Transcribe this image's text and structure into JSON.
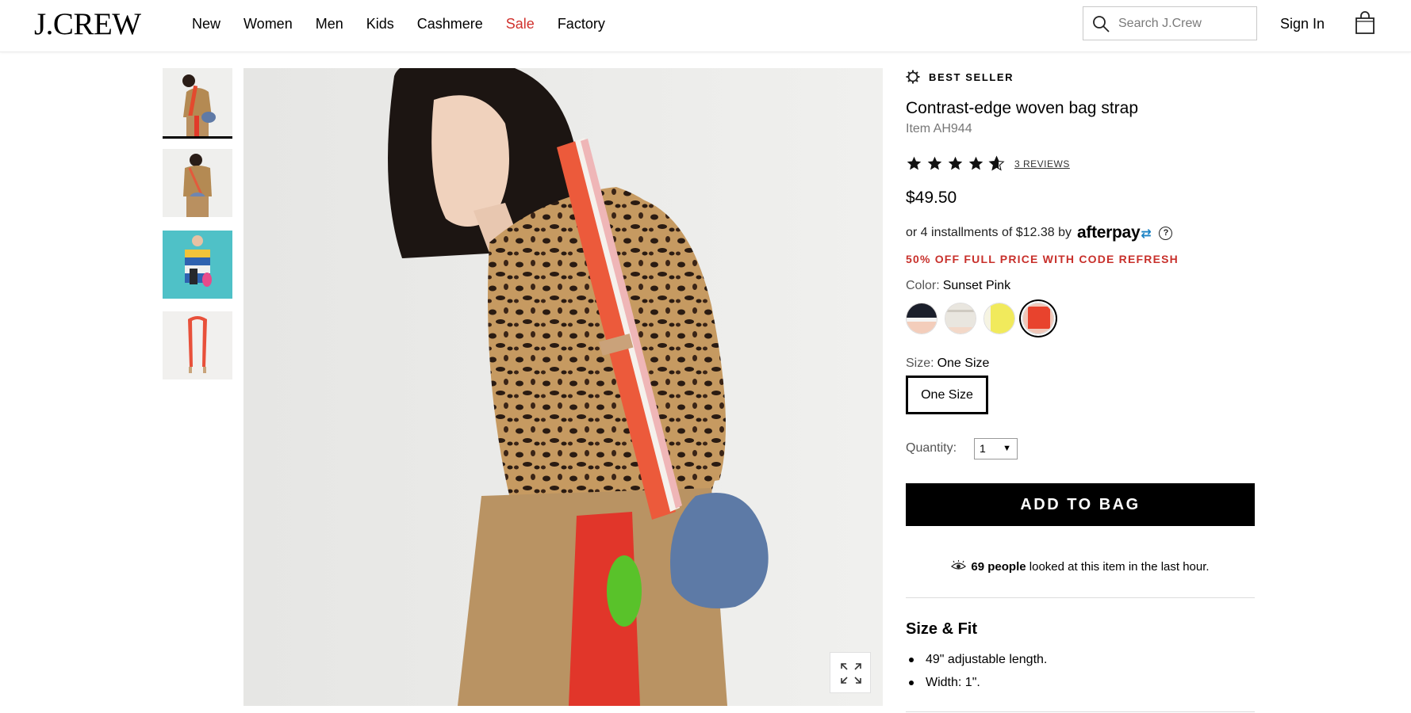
{
  "header": {
    "logo": "J.CREW",
    "nav": [
      "New",
      "Women",
      "Men",
      "Kids",
      "Cashmere",
      "Sale",
      "Factory"
    ],
    "search_placeholder": "Search J.Crew",
    "sign_in": "Sign In"
  },
  "gallery": {
    "thumbnail_count": 4,
    "active_thumbnail": 1
  },
  "product": {
    "badge": "BEST SELLER",
    "title": "Contrast-edge woven bag strap",
    "item_number": "Item AH944",
    "rating": 4.5,
    "reviews_label": "3 REVIEWS",
    "price": "$49.50",
    "installments_text": "or 4 installments of $12.38 by",
    "afterpay_logo": "afterpay",
    "help_icon_glyph": "?",
    "promo": "50% OFF FULL PRICE WITH CODE REFRESH",
    "color_label": "Color:",
    "color_value": "Sunset Pink",
    "swatch_colors": [
      "#1b1f2b",
      "#e9e6df",
      "#f1ea5c",
      "#e8432d"
    ],
    "selected_swatch": 3,
    "size_label": "Size:",
    "size_value": "One Size",
    "size_button": "One Size",
    "quantity_label": "Quantity:",
    "quantity_value": "1",
    "add_to_bag": "ADD TO BAG",
    "viewers_count": "69 people",
    "viewers_text": "looked at this item in the last hour.",
    "size_fit_title": "Size & Fit",
    "size_fit_items": [
      "49\" adjustable length.",
      "Width: 1\"."
    ]
  },
  "colors": {
    "sale": "#d0312d",
    "promo": "#c8302b",
    "afterpay_accent": "#1a82c4"
  }
}
